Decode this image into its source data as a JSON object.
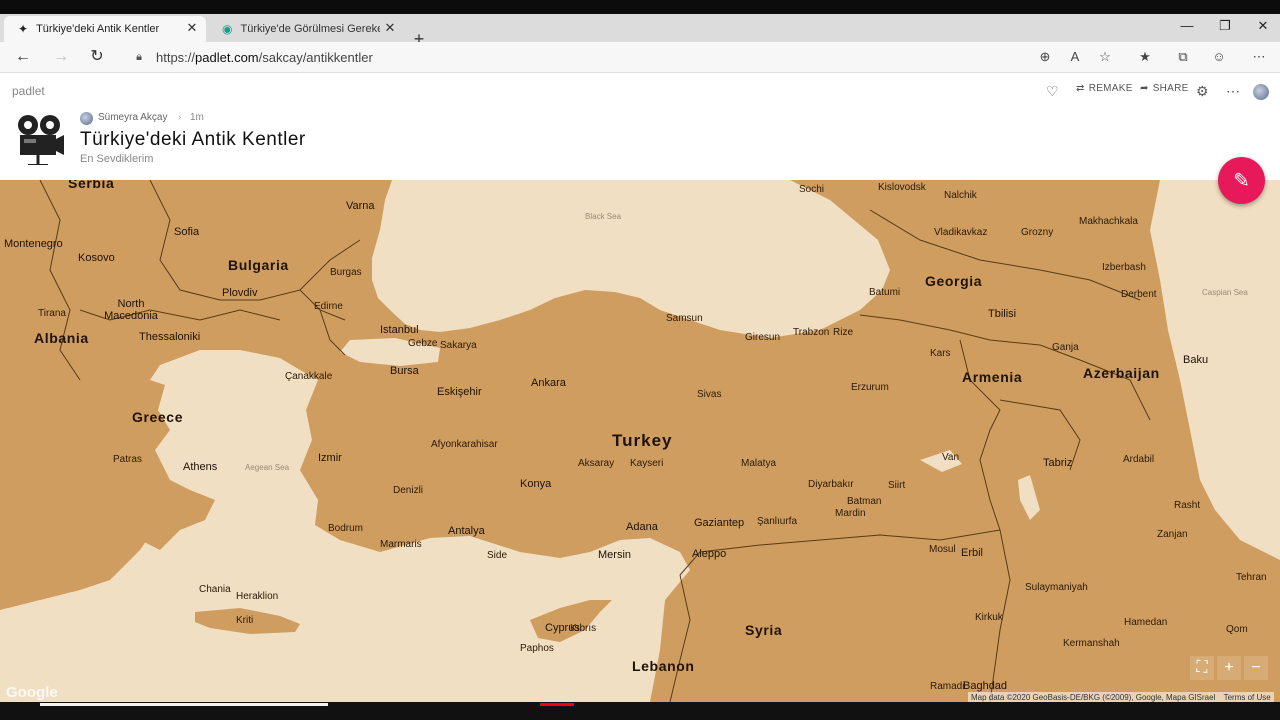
{
  "tabs": [
    {
      "title": "Türkiye'deki Antik Kentler",
      "active": true
    },
    {
      "title": "Türkiye'de Görülmesi Gereken Şehirler",
      "active": false
    }
  ],
  "address": {
    "scheme": "https://",
    "host": "padlet.com",
    "path": "/sakcay/antikkentler"
  },
  "header": {
    "brand": "padlet",
    "remake": "REMAKE",
    "share": "SHARE",
    "author": "Sümeyra Akçay",
    "separator": "›",
    "time": "1m",
    "title": "Türkiye'deki Antik Kentler",
    "subtitle": "En Sevdiklerim"
  },
  "map": {
    "countries": [
      "Bulgaria",
      "North Macedonia",
      "Albania",
      "Greece",
      "Turkey",
      "Georgia",
      "Armenia",
      "Azerbaijan",
      "Syria",
      "Lebanon",
      "Cyprus",
      "Serbia",
      "Montenegro",
      "Kosovo"
    ],
    "seas": [
      "Black Sea",
      "Caspian Sea",
      "Aegean Sea"
    ],
    "cities": [
      "Varna",
      "Sofia",
      "Plovdiv",
      "Burgas",
      "Edirne",
      "Istanbul",
      "Gebze",
      "Sakarya",
      "Bursa",
      "Eskişehir",
      "Ankara",
      "Samsun",
      "Giresun",
      "Trabzon",
      "Rize",
      "Sivas",
      "Erzurum",
      "Kars",
      "Tbilisi",
      "Batumi",
      "Ganja",
      "Baku",
      "Tirana",
      "Thessaloniki",
      "Patras",
      "Athens",
      "Izmir",
      "Afyonkarahisar",
      "Denizli",
      "Konya",
      "Kayseri",
      "Aksaray",
      "Malatya",
      "Van",
      "Tabriz",
      "Ardabil",
      "Rasht",
      "Zanjan",
      "Tehran",
      "Qom",
      "Hamedan",
      "Kermanshah",
      "Sulaymaniyah",
      "Erbil",
      "Mosul",
      "Kirkuk",
      "Baghdad",
      "Diyarbakır",
      "Batman",
      "Siirt",
      "Mardin",
      "Şanlıurfa",
      "Gaziantep",
      "Aleppo",
      "Adana",
      "Mersin",
      "Antalya",
      "Side",
      "Marmaris",
      "Bodrum",
      "Chania",
      "Heraklion",
      "Kriti",
      "Paphos",
      "Sochi",
      "Grozny",
      "Makhachkala",
      "Nalchik",
      "Vladikavkaz",
      "Kislovodsk",
      "Derbent",
      "Izberbash",
      "Çanakkale",
      "Ramadi",
      "Kıbrıs"
    ],
    "attribution": "Map data ©2020 GeoBasis-DE/BKG (©2009), Google, Mapa GISrael",
    "terms": "Terms of Use",
    "logo": "Google"
  },
  "colors": {
    "land": "#cf9d5f",
    "water": "#f1dfc3",
    "fab": "#e8195a"
  }
}
